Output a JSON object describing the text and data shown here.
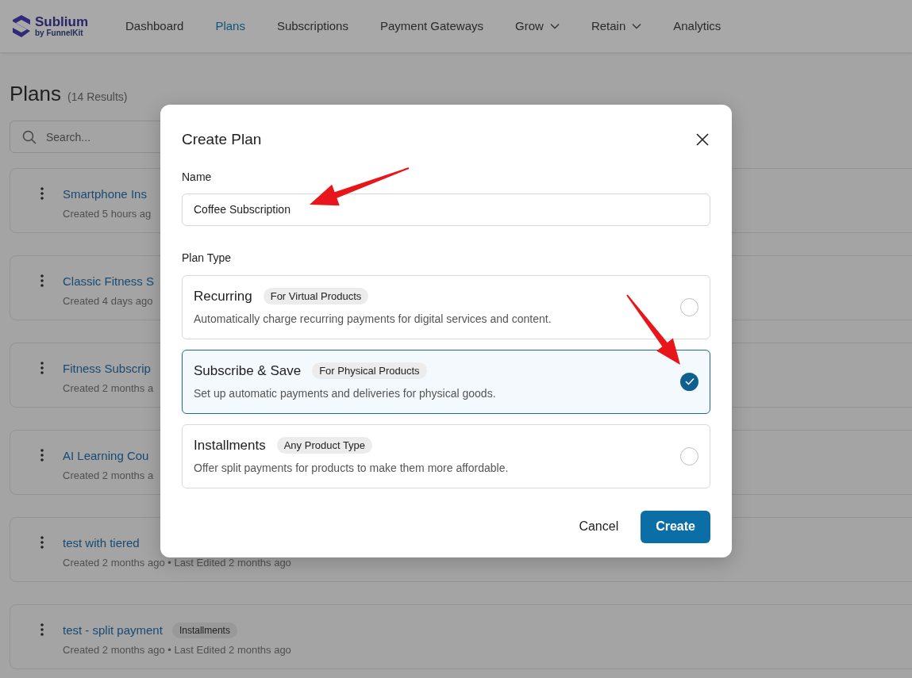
{
  "brand": {
    "name": "Sublium",
    "byline": "by FunnelKit"
  },
  "nav": [
    {
      "label": "Dashboard",
      "selected": false,
      "dropdown": false
    },
    {
      "label": "Plans",
      "selected": true,
      "dropdown": false
    },
    {
      "label": "Subscriptions",
      "selected": false,
      "dropdown": false
    },
    {
      "label": "Payment Gateways",
      "selected": false,
      "dropdown": false
    },
    {
      "label": "Grow",
      "selected": false,
      "dropdown": true
    },
    {
      "label": "Retain",
      "selected": false,
      "dropdown": true
    },
    {
      "label": "Analytics",
      "selected": false,
      "dropdown": false
    }
  ],
  "page": {
    "title": "Plans",
    "count": "(14 Results)",
    "search": {
      "placeholder": "Search..."
    }
  },
  "plans": [
    {
      "title": "Smartphone Ins",
      "meta": "Created 5 hours ag"
    },
    {
      "title": "Classic Fitness S",
      "meta": "Created 4 days ago"
    },
    {
      "title": "Fitness Subscrip",
      "meta": "Created 2 months a"
    },
    {
      "title": "AI Learning Cou",
      "meta": "Created 2 months a"
    },
    {
      "title": "test with tiered",
      "meta": "Created 2 months ago • Last Edited 2 months ago"
    },
    {
      "title": "test - split payment",
      "badge": "Installments",
      "meta": "Created 2 months ago • Last Edited 2 months ago"
    }
  ],
  "dialog": {
    "title": "Create Plan",
    "name_label": "Name",
    "name_value": "Coffee Subscription",
    "type_label": "Plan Type",
    "options": [
      {
        "title": "Recurring",
        "badge": "For Virtual Products",
        "description": "Automatically charge recurring payments for digital services and content.",
        "selected": false
      },
      {
        "title": "Subscribe & Save",
        "badge": "For Physical Products",
        "description": "Set up automatic payments and deliveries for physical goods.",
        "selected": true
      },
      {
        "title": "Installments",
        "badge": "Any Product Type",
        "description": "Offer split payments for products to make them more affordable.",
        "selected": false
      }
    ],
    "buttons": {
      "cancel": "Cancel",
      "create": "Create"
    }
  }
}
